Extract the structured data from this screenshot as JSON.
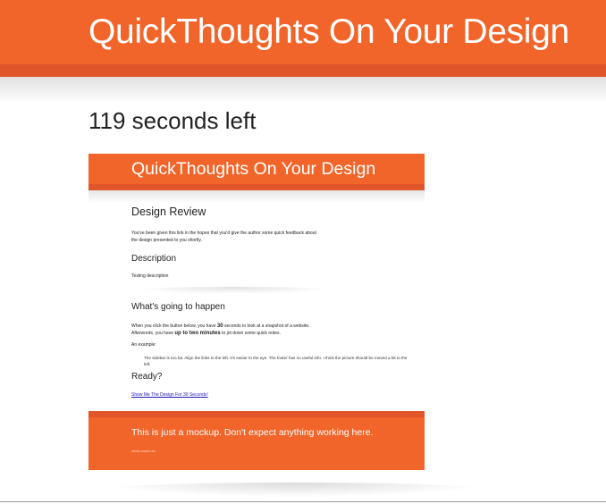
{
  "header": {
    "title": "QuickThoughts On Your Design"
  },
  "countdown": {
    "text": "119 seconds left"
  },
  "snapshot": {
    "header_title": "QuickThoughts On Your Design",
    "design_review": {
      "heading": "Design Review",
      "text_line1": "You've been given this link in the hopes that you'd give the author some quick feedback about",
      "text_line2": "the design presented to you shortly."
    },
    "description": {
      "heading": "Description",
      "text": "Testing description"
    },
    "whats_going": {
      "heading": "What's going to happen",
      "line1_pre": "When you click the button below, you have ",
      "line1_bold": "30",
      "line1_post": " seconds to look at a snapshot of a website.",
      "line2_pre": "Afterwords, you have ",
      "line2_bold": "up to two minutes",
      "line2_post": " to jot down some quick notes.",
      "example_label": "An example:",
      "example_text": "The sidebar is too fat. Align the links to the left. It's easier to the eye. The footer has no useful info. I think the picture should be moved a bit to the left."
    },
    "ready": {
      "heading": "Ready?",
      "link": "Show Me The Design For 30 Seconds!"
    },
    "footer": {
      "note": "This is just a mockup. Don't expect anything working here.",
      "small": "zenlo.com/x.ee"
    }
  },
  "colors": {
    "accent": "#f2652a",
    "accent_dark": "#e1552a"
  }
}
